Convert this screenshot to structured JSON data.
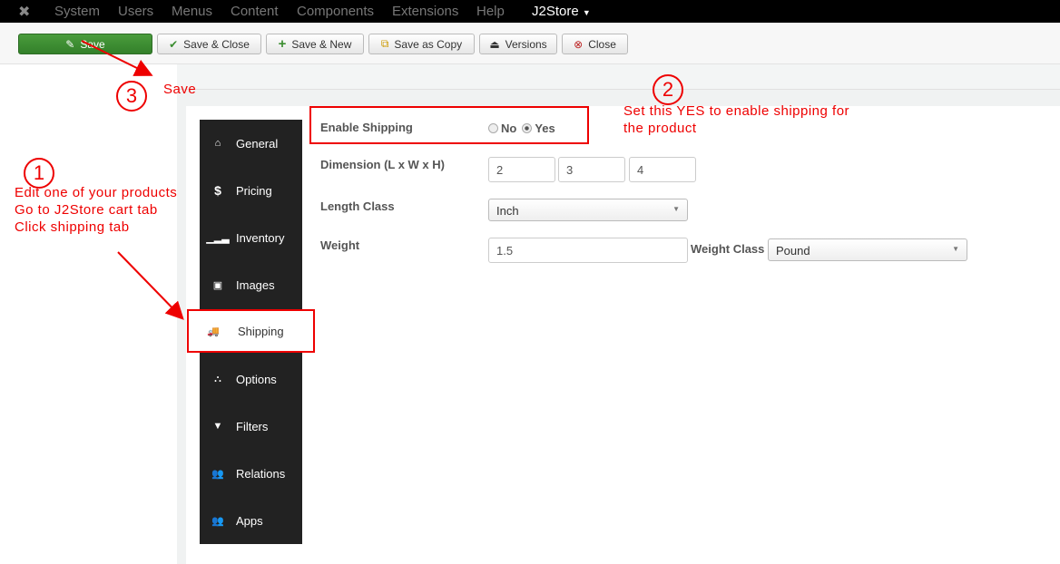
{
  "nav": {
    "items": [
      "System",
      "Users",
      "Menus",
      "Content",
      "Components",
      "Extensions",
      "Help"
    ],
    "j2store": "J2Store"
  },
  "toolbar": {
    "save": "Save",
    "save_close": "Save & Close",
    "save_new": "Save & New",
    "save_copy": "Save as Copy",
    "versions": "Versions",
    "close": "Close"
  },
  "sidebar": {
    "items": [
      "General",
      "Pricing",
      "Inventory",
      "Images",
      "Shipping",
      "Options",
      "Filters",
      "Relations",
      "Apps"
    ]
  },
  "form": {
    "enable_shipping": "Enable Shipping",
    "no": "No",
    "yes": "Yes",
    "selected": "Yes",
    "dimension": "Dimension (L x W x H)",
    "length": "2",
    "width": "3",
    "height": "4",
    "length_class": "Length Class",
    "length_class_value": "Inch",
    "weight": "Weight",
    "weight_value": "1.5",
    "weight_class": "Weight Class",
    "weight_class_value": "Pound"
  },
  "annotations": {
    "n1": "1",
    "n2": "2",
    "n3": "3",
    "step1_l1": "Edit one of your products",
    "step1_l2": "Go to J2Store cart tab",
    "step1_l3": "Click shipping tab",
    "step2_l1": "Set this YES to enable shipping for",
    "step2_l2": "the product",
    "step3": "Save"
  },
  "colors": {
    "accent_red": "#ee0000",
    "save_green": "#3b8d30"
  }
}
